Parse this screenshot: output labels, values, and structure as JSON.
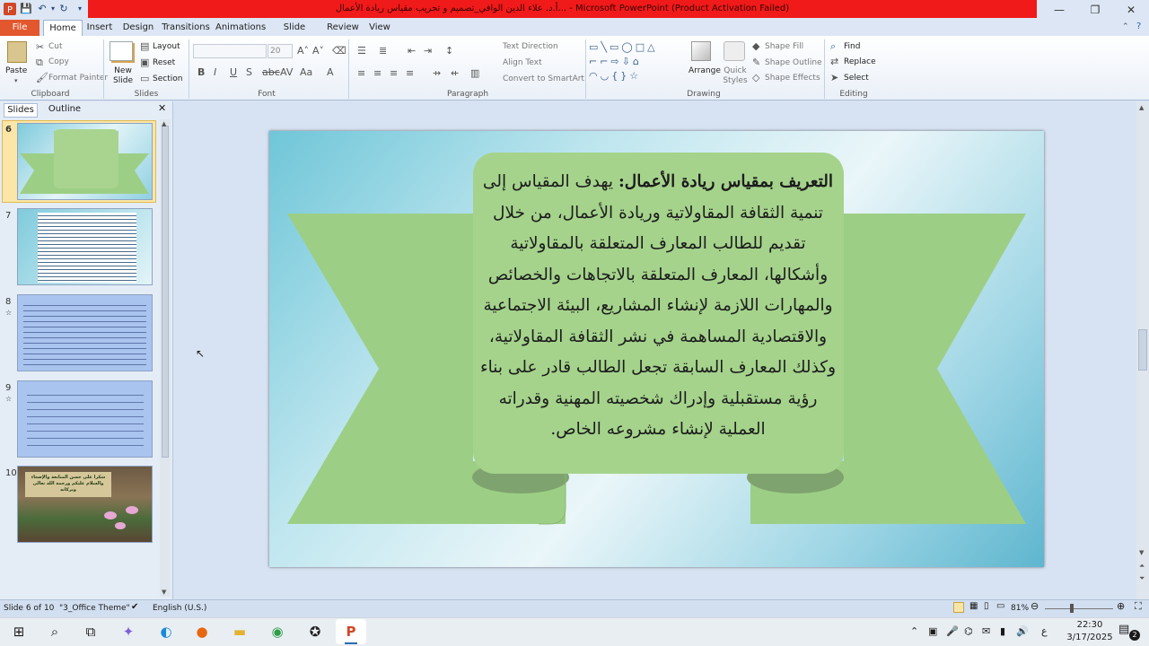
{
  "window": {
    "title": "Microsoft PowerPoint (Product Activation Failed)",
    "doc_title": "أ.د. علاء الدين الوافي_تصميم و تجريب مقياس ريادة الأعمال...",
    "minimize": "—",
    "restore": "❐",
    "close": "✕"
  },
  "tabs": [
    "File",
    "Home",
    "Insert",
    "Design",
    "Transitions",
    "Animations",
    "Slide Show",
    "Review",
    "View"
  ],
  "ribbon": {
    "clipboard": {
      "paste": "Paste",
      "cut": "Cut",
      "copy": "Copy",
      "format_painter": "Format Painter",
      "group": "Clipboard"
    },
    "slides": {
      "new_slide": "New Slide",
      "layout": "Layout",
      "reset": "Reset",
      "section": "Section",
      "group": "Slides"
    },
    "font": {
      "size": "20",
      "group": "Font"
    },
    "paragraph": {
      "text_direction": "Text Direction",
      "align_text": "Align Text",
      "convert": "Convert to SmartArt",
      "group": "Paragraph"
    },
    "drawing": {
      "arrange": "Arrange",
      "quick_styles": "Quick Styles",
      "shape_fill": "Shape Fill",
      "shape_outline": "Shape Outline",
      "shape_effects": "Shape Effects",
      "group": "Drawing"
    },
    "editing": {
      "find": "Find",
      "replace": "Replace",
      "select": "Select",
      "group": "Editing"
    }
  },
  "panel": {
    "tab_slides": "Slides",
    "tab_outline": "Outline",
    "close": "✕",
    "thumbs": [
      {
        "num": "6",
        "label": ""
      },
      {
        "num": "7",
        "label": ""
      },
      {
        "num": "8",
        "label": ""
      },
      {
        "num": "9",
        "label": ""
      },
      {
        "num": "10",
        "label": "شكرا على حسن المتابعة والإصغاء والسلام عليكم ورحمة الله تعالى وبركاته"
      }
    ]
  },
  "slide": {
    "heading": "التعريف بمقياس ريادة الأعمال:",
    "body": "يهدف المقياس إلى تنمية الثقافة المقاولاتية وريادة الأعمال، من خلال تقديم للطالب المعارف المتعلقة بالمقاولاتية وأشكالها، المعارف المتعلقة بالاتجاهات والخصائص والمهارات اللازمة لإنشاء المشاريع، البيئة الاجتماعية والاقتصادية المساهمة في نشر الثقافة المقاولاتية، وكذلك المعارف السابقة تجعل الطالب قادر على بناء رؤية مستقبلية وإدراك شخصيته المهنية وقدراته العملية لإنشاء مشروعه الخاص."
  },
  "colors": {
    "ribbon_green": "#9ccf85",
    "ribbon_dark": "#7fa36e",
    "title_red": "#f01a1a",
    "file_tab": "#e2572e"
  },
  "status": {
    "slide": "Slide 6 of 10",
    "theme": "\"3_Office Theme\"",
    "lang": "English (U.S.)",
    "zoom": "81%"
  },
  "taskbar": {
    "time": "22:30",
    "date": "3/17/2025",
    "lang": "ع",
    "notif": "2"
  }
}
